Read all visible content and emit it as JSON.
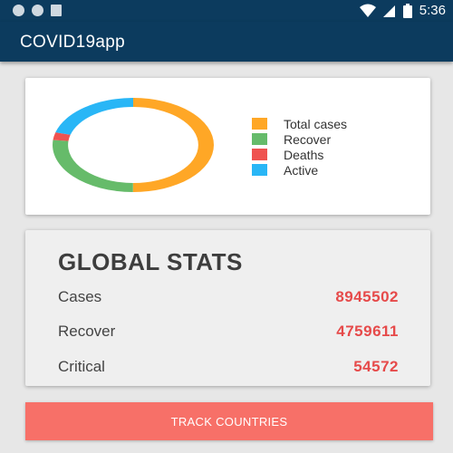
{
  "status_bar": {
    "time": "5:36",
    "icons": [
      "notification-dot-icon",
      "notification-dot-icon",
      "sd-card-icon",
      "wifi-icon",
      "signal-icon",
      "battery-icon"
    ]
  },
  "app_bar": {
    "title": "COVID19app"
  },
  "colors": {
    "primary": "#0c3b5e",
    "total_cases": "#ffa726",
    "recover": "#66bb6a",
    "deaths": "#ef5350",
    "active": "#29b6f6",
    "accent": "#f77068",
    "value_red": "#e64a4a"
  },
  "chart_data": {
    "type": "pie",
    "variant": "donut",
    "legend_position": "right",
    "legend": [
      {
        "label": "Total cases",
        "color": "#ffa726"
      },
      {
        "label": "Recover",
        "color": "#66bb6a"
      },
      {
        "label": "Deaths",
        "color": "#ef5350"
      },
      {
        "label": "Active",
        "color": "#29b6f6"
      }
    ],
    "slices": [
      {
        "name": "Total cases",
        "value": 8945502,
        "color": "#ffa726"
      },
      {
        "name": "Recover",
        "value": 4759611,
        "color": "#66bb6a"
      },
      {
        "name": "Deaths",
        "value": 470000,
        "color": "#ef5350"
      },
      {
        "name": "Active",
        "value": 3700000,
        "color": "#29b6f6"
      }
    ]
  },
  "stats": {
    "title": "GLOBAL STATS",
    "rows": [
      {
        "label": "Cases",
        "value": "8945502"
      },
      {
        "label": "Recover",
        "value": "4759611"
      },
      {
        "label": "Critical",
        "value": "54572"
      }
    ]
  },
  "actions": {
    "track_label": "TRACK COUNTRIES"
  }
}
